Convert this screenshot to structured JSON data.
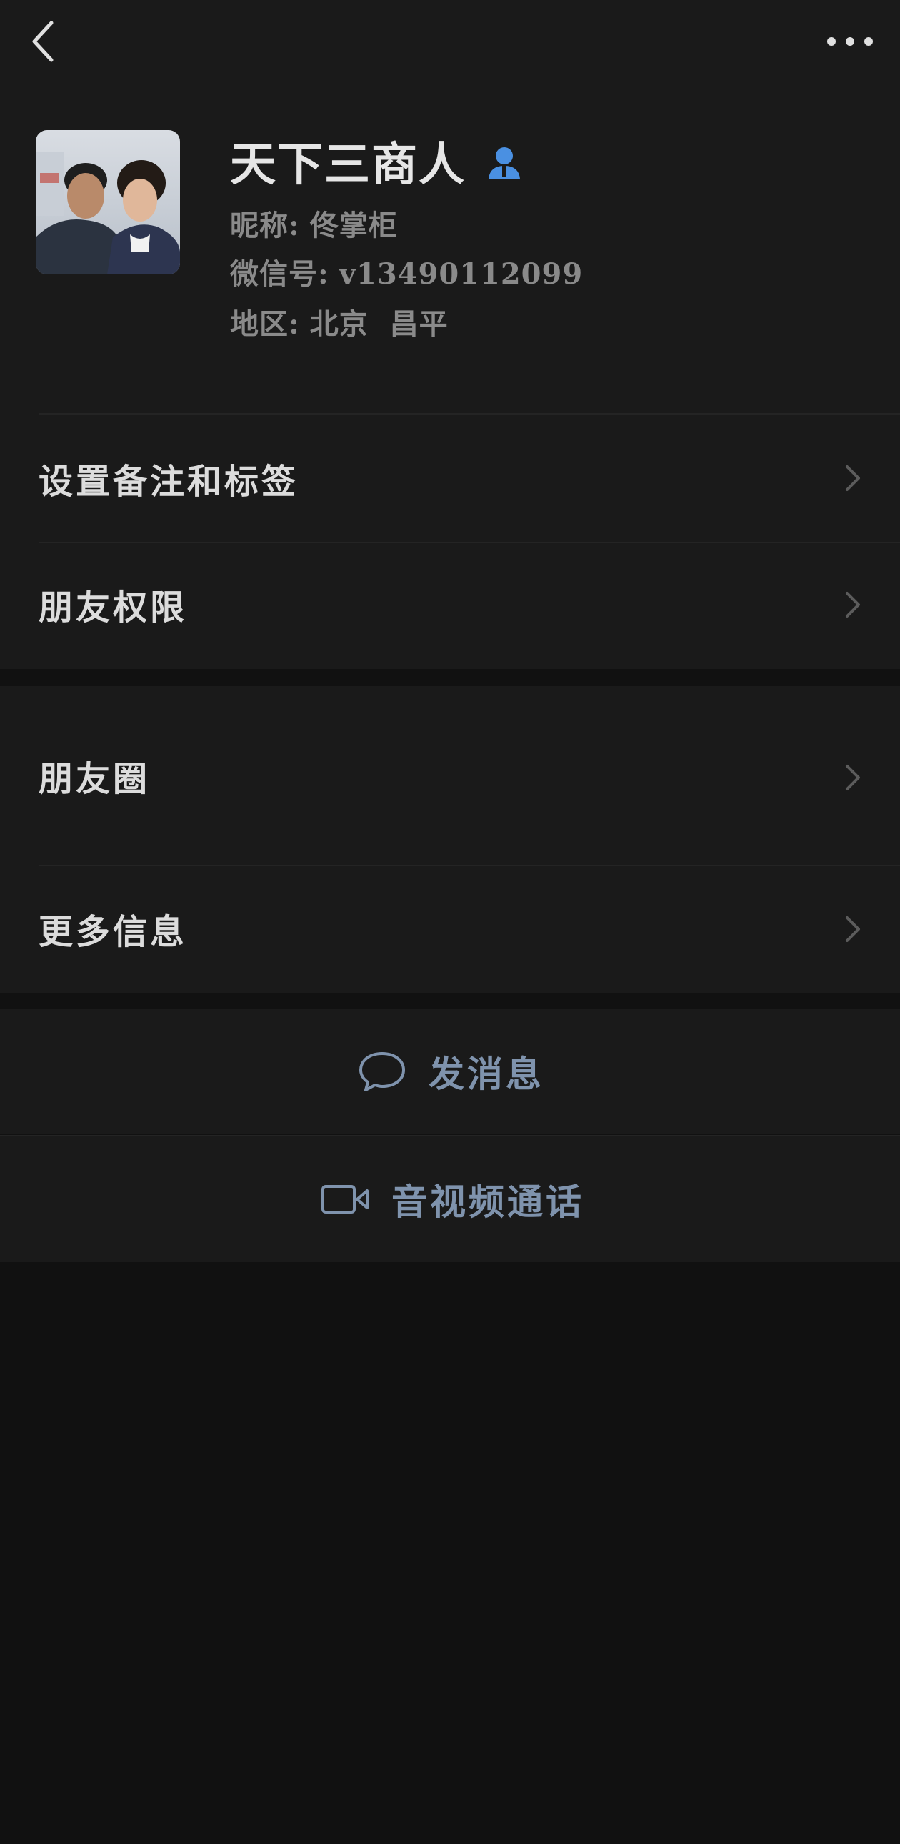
{
  "topbar": {
    "back_icon": "chevron-left-icon",
    "more_icon": "more-dots-icon"
  },
  "profile": {
    "display_name": "天下三商人",
    "badge_icon": "user-badge-icon",
    "badge_color": "#4a90e2",
    "nickname_label": "昵称:",
    "nickname_value": "佟掌柜",
    "wechat_id_label": "微信号:",
    "wechat_id_value": "v13490112099",
    "region_label": "地区:",
    "region_value": "北京  昌平"
  },
  "menu_group_1": {
    "items": [
      {
        "label": "设置备注和标签"
      },
      {
        "label": "朋友权限"
      }
    ]
  },
  "menu_group_2": {
    "items": [
      {
        "label": "朋友圈"
      },
      {
        "label": "更多信息"
      }
    ]
  },
  "actions": {
    "message_label": "发消息",
    "message_icon": "chat-bubble-icon",
    "call_label": "音视频通话",
    "call_icon": "video-camera-icon",
    "accent_color": "#7f93ad"
  }
}
